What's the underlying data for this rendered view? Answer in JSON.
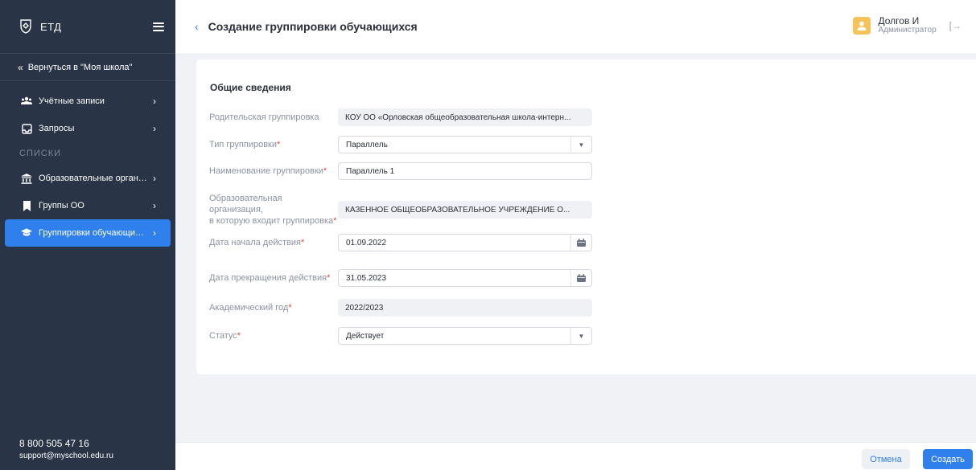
{
  "sidebar": {
    "logo_text": "ЕТД",
    "back_label": "Вернуться в \"Моя школа\"",
    "items": [
      {
        "label": "Учётные записи",
        "icon": "users-icon"
      },
      {
        "label": "Запросы",
        "icon": "inbox-icon"
      }
    ],
    "section_label": "СПИСКИ",
    "list_items": [
      {
        "label": "Образовательные организа...",
        "icon": "institution-icon"
      },
      {
        "label": "Группы ОО",
        "icon": "bookmark-icon"
      },
      {
        "label": "Группировки обучающихся",
        "icon": "graduation-cap-icon",
        "active": true
      }
    ],
    "footer": {
      "phone": "8 800 505 47 16",
      "email": "support@myschool.edu.ru"
    }
  },
  "header": {
    "title": "Создание группировки обучающихся",
    "user_name": "Долгов И",
    "user_role": "Администратор"
  },
  "form": {
    "section_title": "Общие сведения",
    "fields": {
      "parent": {
        "label": "Родительская группировка",
        "value": "КОУ ОО «Орловская общеобразовательная школа-интерн..."
      },
      "type": {
        "label": "Тип группировки",
        "value": "Параллель"
      },
      "name": {
        "label": "Наименование группировки",
        "value": "Параллель 1"
      },
      "org": {
        "label_line1": "Образовательная организация,",
        "label_line2": "в которую входит группировка",
        "value": "КАЗЕННОЕ ОБЩЕОБРАЗОВАТЕЛЬНОЕ УЧРЕЖДЕНИЕ О..."
      },
      "start_date": {
        "label": "Дата начала действия",
        "value": "01.09.2022"
      },
      "end_date": {
        "label": "Дата прекращения действия",
        "value": "31.05.2023"
      },
      "academic_year": {
        "label": "Академический год",
        "value": "2022/2023"
      },
      "status": {
        "label": "Статус",
        "value": "Действует"
      }
    }
  },
  "actions": {
    "cancel_label": "Отмена",
    "create_label": "Создать"
  },
  "colors": {
    "sidebar_bg": "#2a3447",
    "accent": "#2f80ed",
    "required": "#e04646"
  }
}
